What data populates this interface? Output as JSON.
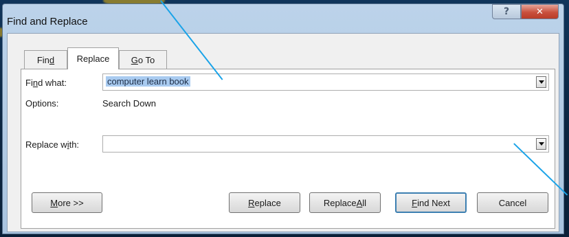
{
  "window": {
    "title": "Find and Replace",
    "help_glyph": "?",
    "close_glyph": "✕"
  },
  "tabs": [
    {
      "label_pre": "Fin",
      "label_u": "d",
      "label_post": "",
      "active": false
    },
    {
      "label_pre": "Re",
      "label_u": "p",
      "label_post": "lace",
      "active": true
    },
    {
      "label_pre": "",
      "label_u": "G",
      "label_post": "o To",
      "active": false
    }
  ],
  "find": {
    "label_pre": "Fi",
    "label_u": "n",
    "label_post": "d what:",
    "value": "computer learn book"
  },
  "options": {
    "label": "Options:",
    "value": "Search Down"
  },
  "replace": {
    "label_pre": "Replace w",
    "label_u": "i",
    "label_post": "th:",
    "value": ""
  },
  "buttons": {
    "more": {
      "pre": "",
      "u": "M",
      "post": "ore >>"
    },
    "replace": {
      "pre": "",
      "u": "R",
      "post": "eplace"
    },
    "replace_all": {
      "pre": "Replace ",
      "u": "A",
      "post": "ll"
    },
    "find_next": {
      "pre": "",
      "u": "F",
      "post": "ind Next"
    },
    "cancel": {
      "pre": "Cancel",
      "u": "",
      "post": ""
    }
  },
  "colors": {
    "desktop": "#0e2743",
    "window_frame": "#bcd3ea",
    "selection": "#a9cbf0",
    "pointer_line": "#1aa3e8",
    "default_button_border": "#3c7fb1"
  }
}
